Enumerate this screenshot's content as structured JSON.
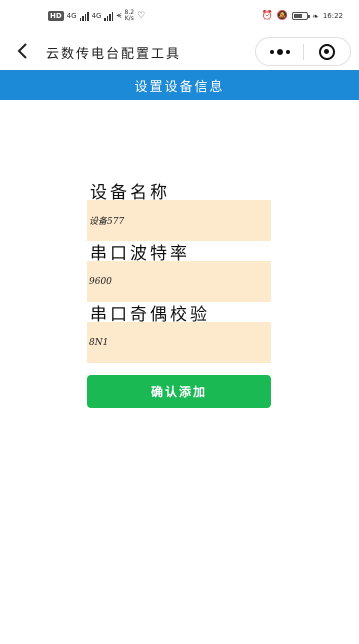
{
  "status_bar": {
    "hd_badge": "HD",
    "signal1": "4G",
    "signal2": "4G",
    "speed_value": "8.2",
    "speed_unit": "K/s",
    "time": "16:22"
  },
  "nav": {
    "title": "云数传电台配置工具"
  },
  "banner": {
    "title": "设置设备信息"
  },
  "form": {
    "device_name_label": "设备名称",
    "device_name_value": "设备577",
    "baud_rate_label": "串口波特率",
    "baud_rate_value": "9600",
    "parity_label": "串口奇偶校验",
    "parity_value": "8N1",
    "submit_label": "确认添加"
  },
  "colors": {
    "banner": "#1c8ad6",
    "field_bg": "#fde9cc",
    "submit_bg": "#1ab954"
  }
}
